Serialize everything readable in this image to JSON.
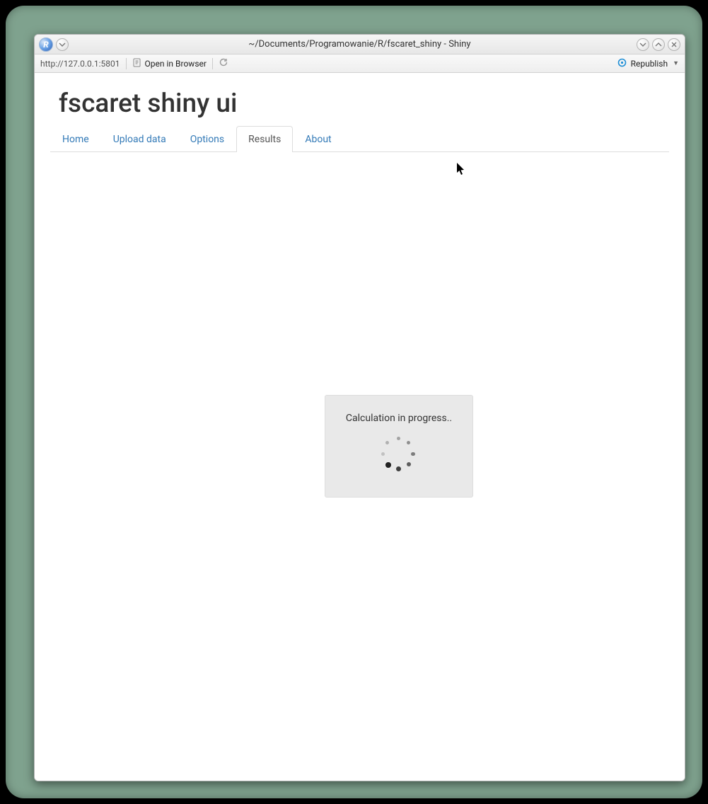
{
  "window": {
    "title": "~/Documents/Programowanie/R/fscaret_shiny - Shiny"
  },
  "toolbar": {
    "url": "http://127.0.0.1:5801",
    "open_browser_label": "Open in Browser",
    "republish_label": "Republish"
  },
  "app": {
    "title": "fscaret shiny ui",
    "tabs": [
      {
        "label": "Home",
        "active": false
      },
      {
        "label": "Upload data",
        "active": false
      },
      {
        "label": "Options",
        "active": false
      },
      {
        "label": "Results",
        "active": true
      },
      {
        "label": "About",
        "active": false
      }
    ],
    "status_message": "Calculation in progress.."
  }
}
